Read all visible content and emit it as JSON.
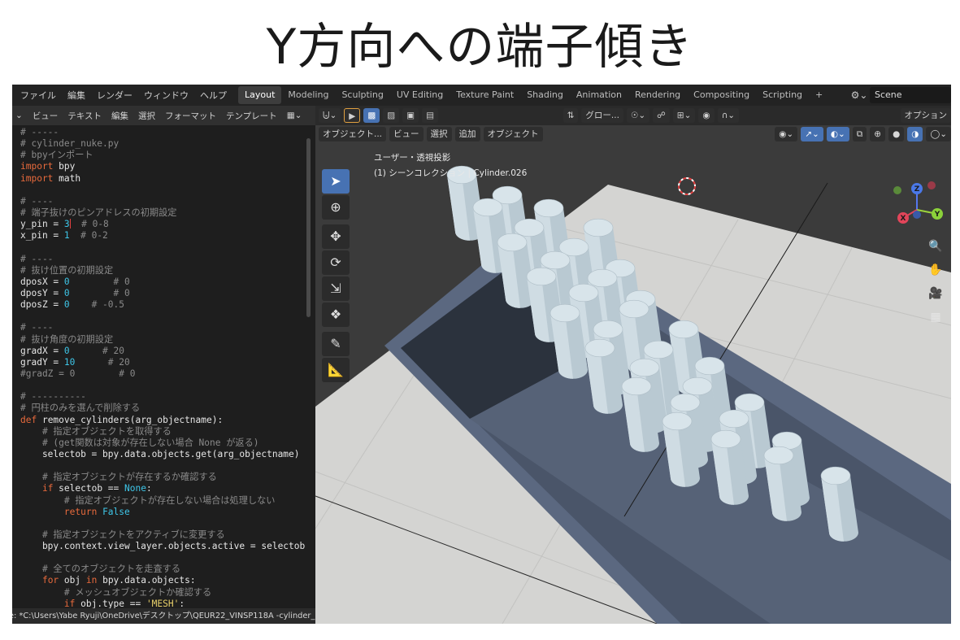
{
  "slide_title": "Y方向への端子傾き",
  "topbar": {
    "menu": [
      "ファイル",
      "編集",
      "レンダー",
      "ウィンドウ",
      "ヘルプ"
    ],
    "tabs": [
      "Layout",
      "Modeling",
      "Sculpting",
      "UV Editing",
      "Texture Paint",
      "Shading",
      "Animation",
      "Rendering",
      "Compositing",
      "Scripting",
      "+"
    ],
    "active_tab": "Layout",
    "scene_name": "Scene"
  },
  "editor": {
    "menu": [
      "ビュー",
      "テキスト",
      "編集",
      "選択",
      "フォーマット",
      "テンプレート"
    ],
    "status_path": "e: *C:\\Users\\Yabe Ryuji\\OneDrive\\デスクトップ\\QEUR22_VINSP118A -cylinder_nu",
    "code_lines": [
      [
        [
          "c",
          "# -----"
        ]
      ],
      [
        [
          "c",
          "# cylinder_nuke.py"
        ]
      ],
      [
        [
          "c",
          "# bpyインポート"
        ]
      ],
      [
        [
          "k",
          "import"
        ],
        [
          "t",
          " bpy"
        ]
      ],
      [
        [
          "k",
          "import"
        ],
        [
          "t",
          " math"
        ]
      ],
      [
        [
          "t",
          ""
        ]
      ],
      [
        [
          "c",
          "# ----"
        ]
      ],
      [
        [
          "c",
          "# 端子抜けのピンアドレスの初期設定"
        ]
      ],
      [
        [
          "t",
          "y_pin = "
        ],
        [
          "n",
          "3"
        ],
        [
          "cur",
          ""
        ],
        [
          "c",
          "  # 0-8"
        ]
      ],
      [
        [
          "t",
          "x_pin = "
        ],
        [
          "n",
          "1"
        ],
        [
          "c",
          "  # 0-2"
        ]
      ],
      [
        [
          "t",
          ""
        ]
      ],
      [
        [
          "c",
          "# ----"
        ]
      ],
      [
        [
          "c",
          "# 抜け位置の初期設定"
        ]
      ],
      [
        [
          "t",
          "dposX = "
        ],
        [
          "n",
          "0"
        ],
        [
          "c",
          "        # 0"
        ]
      ],
      [
        [
          "t",
          "dposY = "
        ],
        [
          "n",
          "0"
        ],
        [
          "c",
          "        # 0"
        ]
      ],
      [
        [
          "t",
          "dposZ = "
        ],
        [
          "n",
          "0"
        ],
        [
          "c",
          "    # -0.5"
        ]
      ],
      [
        [
          "t",
          ""
        ]
      ],
      [
        [
          "c",
          "# ----"
        ]
      ],
      [
        [
          "c",
          "# 抜け角度の初期設定"
        ]
      ],
      [
        [
          "t",
          "gradX = "
        ],
        [
          "n",
          "0"
        ],
        [
          "c",
          "      # 20"
        ]
      ],
      [
        [
          "t",
          "gradY = "
        ],
        [
          "n",
          "10"
        ],
        [
          "c",
          "      # 20"
        ]
      ],
      [
        [
          "c",
          "#gradZ = 0        # 0"
        ]
      ],
      [
        [
          "t",
          ""
        ]
      ],
      [
        [
          "c",
          "# ----------"
        ]
      ],
      [
        [
          "c",
          "# 円柱のみを選んで削除する"
        ]
      ],
      [
        [
          "k",
          "def"
        ],
        [
          "t",
          " remove_cylinders(arg_objectname):"
        ]
      ],
      [
        [
          "c",
          "    # 指定オブジェクトを取得する"
        ]
      ],
      [
        [
          "c",
          "    # (get関数は対象が存在しない場合 None が返る)"
        ]
      ],
      [
        [
          "t",
          "    selectob = bpy.data.objects.get(arg_objectname)"
        ]
      ],
      [
        [
          "t",
          ""
        ]
      ],
      [
        [
          "c",
          "    # 指定オブジェクトが存在するか確認する"
        ]
      ],
      [
        [
          "t",
          "    "
        ],
        [
          "k",
          "if"
        ],
        [
          "t",
          " selectob == "
        ],
        [
          "n",
          "None"
        ],
        [
          "t",
          ":"
        ]
      ],
      [
        [
          "c",
          "        # 指定オブジェクトが存在しない場合は処理しない"
        ]
      ],
      [
        [
          "t",
          "        "
        ],
        [
          "k",
          "return"
        ],
        [
          "t",
          " "
        ],
        [
          "n",
          "False"
        ]
      ],
      [
        [
          "t",
          ""
        ]
      ],
      [
        [
          "c",
          "    # 指定オブジェクトをアクティブに変更する"
        ]
      ],
      [
        [
          "t",
          "    bpy.context.view_layer.objects.active = selectob"
        ]
      ],
      [
        [
          "t",
          ""
        ]
      ],
      [
        [
          "c",
          "    # 全てのオブジェクトを走査する"
        ]
      ],
      [
        [
          "t",
          "    "
        ],
        [
          "k",
          "for"
        ],
        [
          "t",
          " obj "
        ],
        [
          "k",
          "in"
        ],
        [
          "t",
          " bpy.data.objects:"
        ]
      ],
      [
        [
          "c",
          "        # メッシュオブジェクトか確認する"
        ]
      ],
      [
        [
          "t",
          "        "
        ],
        [
          "k",
          "if"
        ],
        [
          "t",
          " obj.type == "
        ],
        [
          "s",
          "'MESH'"
        ],
        [
          "t",
          ":"
        ]
      ]
    ]
  },
  "viewport": {
    "mode_button": "オブジェクト...",
    "header_menu": [
      "ビュー",
      "選択",
      "追加",
      "オブジェクト"
    ],
    "transform_orientation": "グロー...",
    "options_label": "オプション",
    "view_name": "ユーザー・透視投影",
    "collection_info": "(1) シーンコレクション | Cylinder.026",
    "gizmo_labels": [
      "Z",
      "Y",
      "X"
    ]
  },
  "colors": {
    "accent_blue": "#4772b3",
    "floor": "#d6d6d4",
    "box_wall": "#56637a",
    "cylinder": "#d8e4ea",
    "keyword": "#e86a3c",
    "number": "#3ec6e8",
    "comment": "#8a8a8a"
  }
}
